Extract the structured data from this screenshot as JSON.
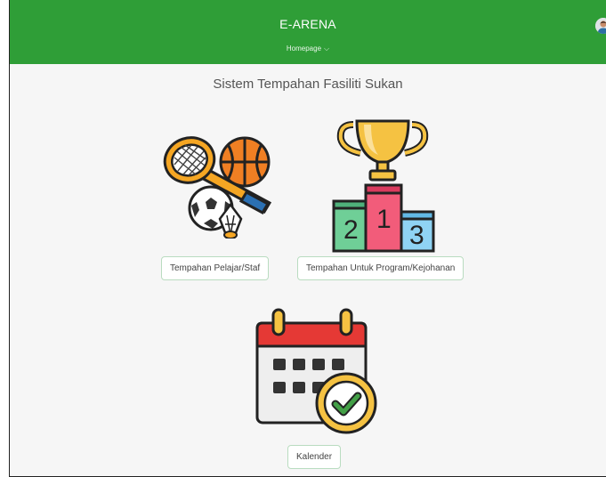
{
  "header": {
    "title": "E-ARENA",
    "nav_label": "Homepage",
    "nav_chevron": "⌵",
    "bg_color": "#2f9e37"
  },
  "main": {
    "title": "Sistem Tempahan Fasiliti Sukan",
    "cards": [
      {
        "label": "Tempahan Pelajar/Staf",
        "icon": "sports-equipment-icon"
      },
      {
        "label": "Tempahan Untuk Program/Kejohanan",
        "icon": "trophy-podium-icon"
      },
      {
        "label": "Kalender",
        "icon": "calendar-check-icon"
      }
    ],
    "podium_numbers": [
      "2",
      "1",
      "3"
    ]
  }
}
